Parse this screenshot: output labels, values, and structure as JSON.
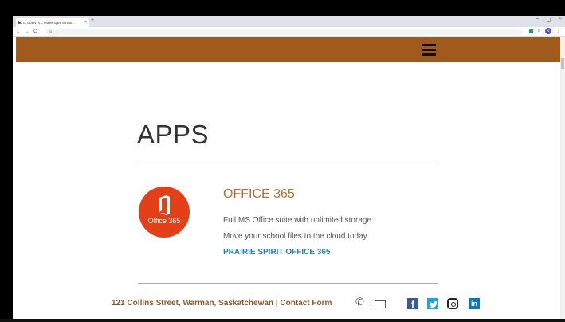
{
  "browser": {
    "tab_title": "STUDENTS – Prairie Spirit School…",
    "tab_close": "×",
    "new_tab": "+",
    "win_minimize": "–",
    "win_maximize": "▢",
    "win_close": "×",
    "nav_back": "←",
    "nav_forward": "→",
    "nav_reload": "C",
    "url_prefix": "G",
    "avatar_letter": "N",
    "menu_dots": "⋮"
  },
  "page": {
    "title": "APPS",
    "apps": [
      {
        "name": "OFFICE 365",
        "logo_label": "Office 365",
        "desc_line1": "Full MS Office suite with unlimited storage.",
        "desc_line2": "Move your school files to the cloud today.",
        "link": "PRAIRIE SPIRIT OFFICE 365"
      }
    ]
  },
  "footer": {
    "address": "121 Collins Street, Warman, Saskatchewan | Contact Form",
    "facebook_glyph": "f",
    "linkedin_glyph": "in"
  },
  "colors": {
    "header_band": "#a05a1c",
    "accent_title": "#b5702c",
    "link": "#2a7bbf",
    "office_logo": "#e3401a"
  },
  "icons": [
    "phone-icon",
    "mail-icon",
    "facebook-icon",
    "twitter-icon",
    "instagram-icon",
    "linkedin-icon",
    "hamburger-menu-icon"
  ]
}
